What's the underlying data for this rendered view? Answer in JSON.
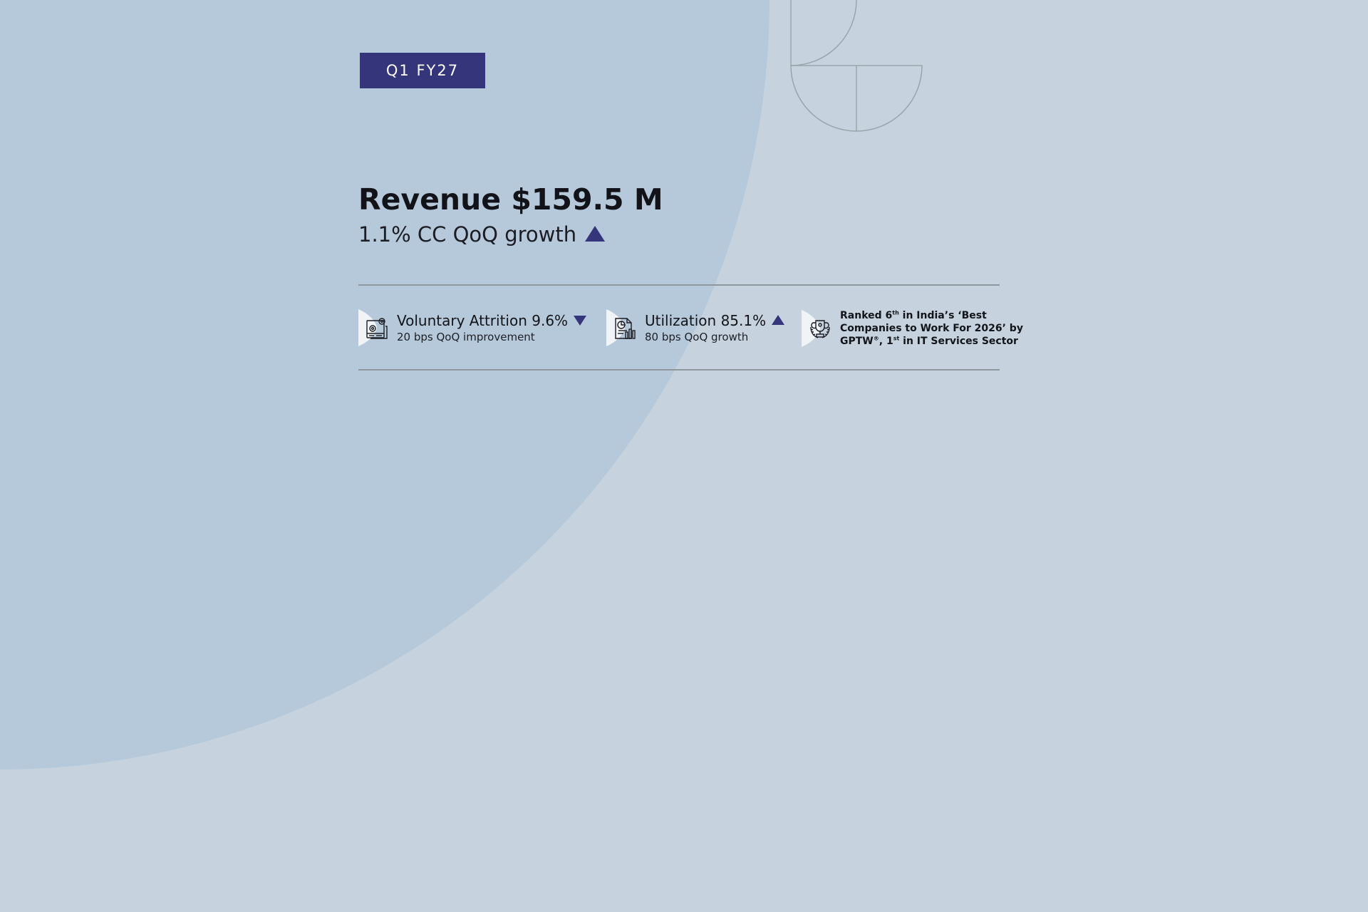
{
  "colors": {
    "background": "#c6d3df",
    "quarter_circle": "#b6c9da",
    "accent": "#34357a",
    "rule": "#8f989f",
    "text": "#111318"
  },
  "badge": {
    "label": "Q1 FY27"
  },
  "headline": {
    "title": "Revenue $159.5 M",
    "subtitle": "1.1% CC QoQ growth",
    "trend": "up"
  },
  "metrics": [
    {
      "icon": "attrition-icon",
      "title": "Voluntary Attrition 9.6%",
      "subtitle": "20 bps QoQ improvement",
      "trend": "down"
    },
    {
      "icon": "utilization-report-icon",
      "title": "Utilization 85.1%",
      "subtitle": "80 bps QoQ growth",
      "trend": "up"
    }
  ],
  "award": {
    "icon": "award-trophy-icon",
    "line1_pre": "Ranked 6",
    "line1_sup": "th",
    "line1_post": " in India’s ‘Best",
    "line2": "Companies to Work For 2026’ by",
    "line3_pre": "GPTW",
    "line3_sup1": "®",
    "line3_mid": ", 1",
    "line3_sup2": "st",
    "line3_post": " in IT Services Sector"
  }
}
